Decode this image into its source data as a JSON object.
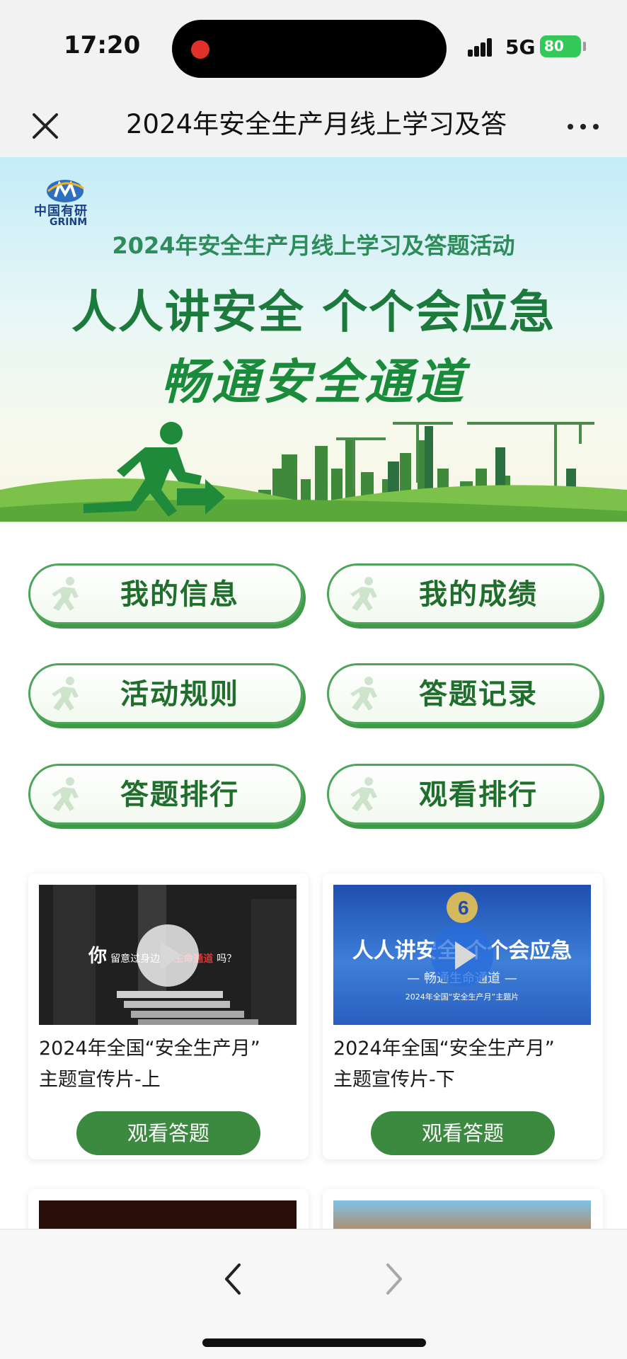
{
  "status_bar": {
    "time": "17:20",
    "network": "5G",
    "battery": "80"
  },
  "title_bar": {
    "title": "2024年安全生产月线上学习及答"
  },
  "banner": {
    "logo_cn": "中国有研",
    "logo_en": "GRINM",
    "subtitle": "2024年安全生产月线上学习及答题活动",
    "slogan1": "人人讲安全 个个会应急",
    "slogan2": "畅通安全通道"
  },
  "menu": [
    {
      "label": "我的信息"
    },
    {
      "label": "我的成绩"
    },
    {
      "label": "活动规则"
    },
    {
      "label": "答题记录"
    },
    {
      "label": "答题排行"
    },
    {
      "label": "观看排行"
    }
  ],
  "videos": [
    {
      "title_line1": "2024年全国“安全生产月”",
      "title_line2": "主题宣传片-上",
      "button": "观看答题",
      "thumb_text_big": "你",
      "thumb_text_a": "留意过身边的",
      "thumb_text_red": "生命通道",
      "thumb_text_b": "吗？"
    },
    {
      "title_line1": "2024年全国“安全生产月”",
      "title_line2": "主题宣传片-下",
      "button": "观看答题",
      "thumb_text_main": "人人讲安全 个个会应急",
      "thumb_text_sub": "— 畅通生命通道 —",
      "thumb_text_small": "2024年全国“安全生产月”主题片"
    }
  ],
  "colors": {
    "accent": "#3b8a3f",
    "border_green": "#4da55a",
    "text_green": "#1f6e2c"
  }
}
